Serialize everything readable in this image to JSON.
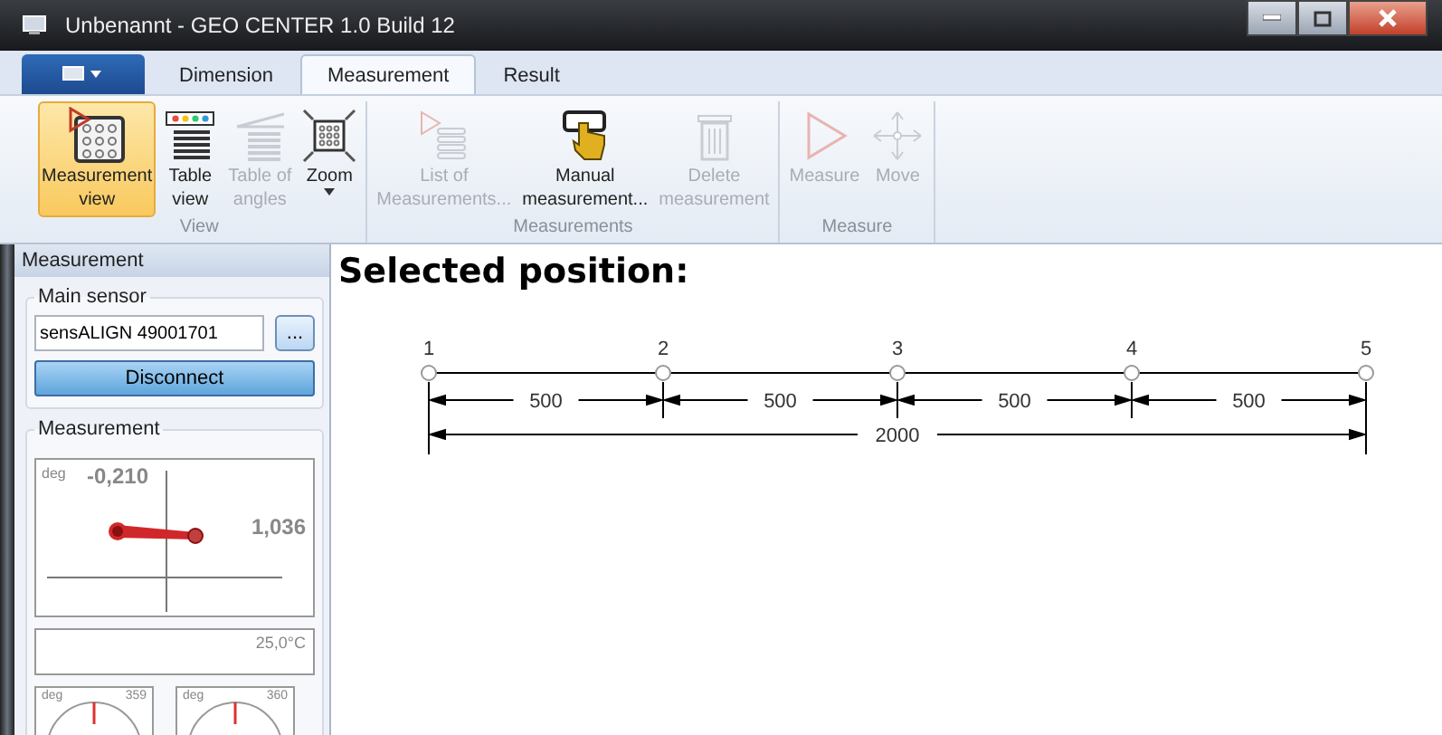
{
  "window": {
    "title": "Unbenannt - GEO CENTER 1.0 Build 12"
  },
  "tabs": [
    {
      "label": "Dimension",
      "selected": false
    },
    {
      "label": "Measurement",
      "selected": true
    },
    {
      "label": "Result",
      "selected": false
    }
  ],
  "ribbon": {
    "groups": [
      {
        "label": "View",
        "buttons": [
          {
            "lines": [
              "Measurement",
              "view"
            ],
            "kind": "grid",
            "selected": true,
            "disabled": false
          },
          {
            "lines": [
              "Table",
              "view"
            ],
            "kind": "table",
            "selected": false,
            "disabled": false
          },
          {
            "lines": [
              "Table of",
              "angles"
            ],
            "kind": "angles",
            "selected": false,
            "disabled": true
          },
          {
            "lines": [
              "Zoom"
            ],
            "kind": "zoom",
            "selected": false,
            "disabled": false,
            "dropdown": true
          }
        ]
      },
      {
        "label": "Measurements",
        "buttons": [
          {
            "lines": [
              "List of",
              "Measurements..."
            ],
            "kind": "list",
            "selected": false,
            "disabled": true
          },
          {
            "lines": [
              "Manual",
              "measurement..."
            ],
            "kind": "hand",
            "selected": false,
            "disabled": false
          },
          {
            "lines": [
              "Delete",
              "measurement"
            ],
            "kind": "trash",
            "selected": false,
            "disabled": true
          }
        ]
      },
      {
        "label": "Measure",
        "buttons": [
          {
            "lines": [
              "Measure"
            ],
            "kind": "play",
            "selected": false,
            "disabled": true
          },
          {
            "lines": [
              "Move"
            ],
            "kind": "move",
            "selected": false,
            "disabled": true
          }
        ]
      }
    ]
  },
  "sidebar": {
    "title": "Measurement",
    "main_sensor": {
      "label": "Main sensor",
      "value": "sensALIGN 49001701",
      "browse": "...",
      "button": "Disconnect"
    },
    "measurement": {
      "label": "Measurement",
      "unit": "deg",
      "vertical": "-0,210",
      "horizontal": "1,036",
      "temperature": "25,0°C",
      "gauges": [
        {
          "unit": "deg",
          "reading": "359"
        },
        {
          "unit": "deg",
          "reading": "360"
        }
      ]
    }
  },
  "main": {
    "heading": "Selected position:",
    "diagram": {
      "points": [
        "1",
        "2",
        "3",
        "4",
        "5"
      ],
      "segments": [
        "500",
        "500",
        "500",
        "500"
      ],
      "total": "2000"
    }
  }
}
